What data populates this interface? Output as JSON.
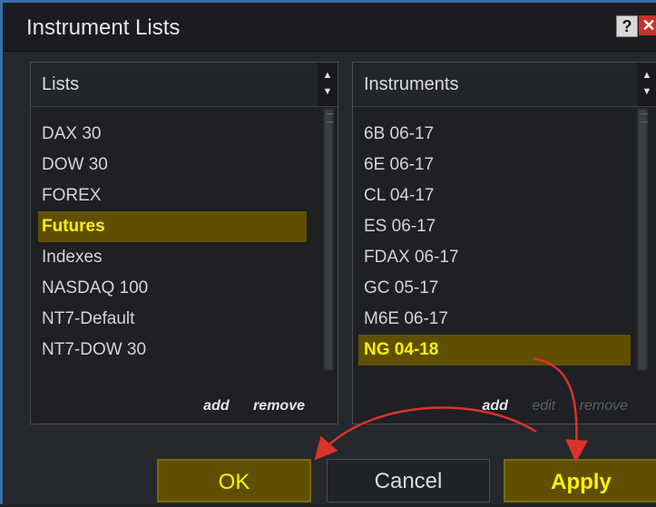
{
  "window": {
    "title": "Instrument Lists",
    "help_label": "?",
    "close_label": "✕"
  },
  "lists_panel": {
    "header": "Lists",
    "items": [
      "DAX 30",
      "DOW 30",
      "FOREX",
      "Futures",
      "Indexes",
      "NASDAQ 100",
      "NT7-Default",
      "NT7-DOW 30"
    ],
    "selected_index": 3,
    "actions": {
      "add": "add",
      "remove": "remove"
    }
  },
  "instruments_panel": {
    "header": "Instruments",
    "items": [
      "6B 06-17",
      "6E 06-17",
      "CL 04-17",
      "ES 06-17",
      "FDAX 06-17",
      "GC 05-17",
      "M6E 06-17",
      "NG 04-18"
    ],
    "selected_index": 7,
    "actions": {
      "add": "add",
      "edit": "edit",
      "remove": "remove"
    }
  },
  "buttons": {
    "ok": "OK",
    "cancel": "Cancel",
    "apply": "Apply"
  },
  "colors": {
    "highlight_bg": "#5f5000",
    "highlight_text": "#fff200",
    "annotation_arrow": "#d9332b"
  }
}
